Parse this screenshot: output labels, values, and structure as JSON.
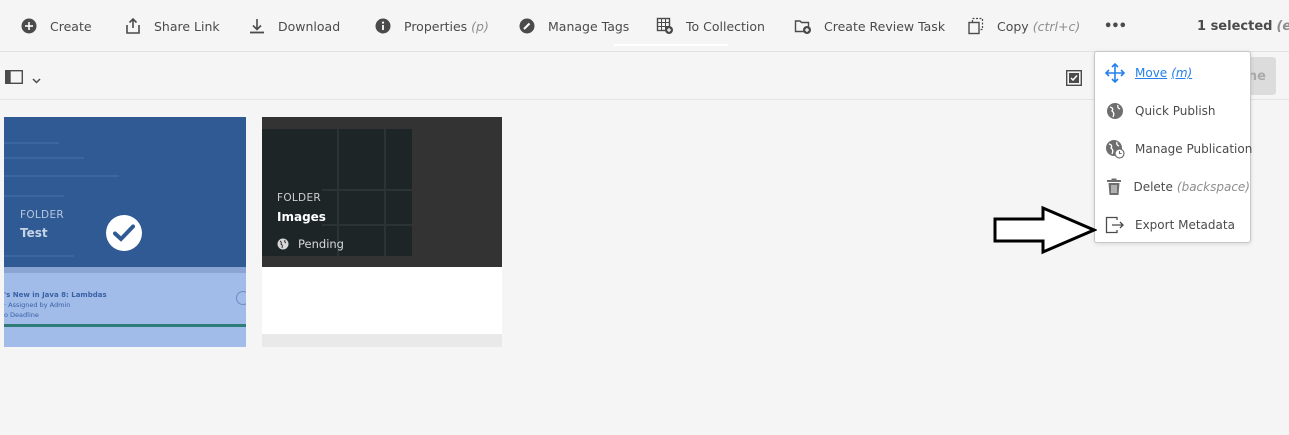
{
  "actionbar": {
    "create": "Create",
    "share_link": "Share Link",
    "download": "Download",
    "properties": "Properties",
    "properties_shortcut": "(p)",
    "manage_tags": "Manage Tags",
    "to_collection": "To Collection",
    "create_review_task": "Create Review Task",
    "copy": "Copy",
    "copy_shortcut": "(ctrl+c)",
    "more": "•••",
    "selected_count": "1 selected",
    "selected_shortcut": "(escape)"
  },
  "subbar": {
    "done_label": "Done"
  },
  "cards": [
    {
      "type": "FOLDER",
      "name": "Test",
      "thumb_text_1": "'s New in Java 8: Lambdas",
      "thumb_text_2": "· Assigned by Admin",
      "thumb_text_3": "o Deadline"
    },
    {
      "type": "FOLDER",
      "name": "Images",
      "status": "Pending"
    }
  ],
  "menu": {
    "items": [
      {
        "label": "Move",
        "shortcut": "(m)",
        "icon": "move-icon"
      },
      {
        "label": "Quick Publish",
        "shortcut": "",
        "icon": "globe-icon"
      },
      {
        "label": "Manage Publication",
        "shortcut": "",
        "icon": "globe-clock-icon"
      },
      {
        "label": "Delete",
        "shortcut": "(backspace)",
        "icon": "trash-icon"
      },
      {
        "label": "Export Metadata",
        "shortcut": "",
        "icon": "export-icon"
      }
    ]
  },
  "colors": {
    "accent": "#2680eb",
    "selected_card": "#2f5a94",
    "text": "#4b4b4b"
  }
}
